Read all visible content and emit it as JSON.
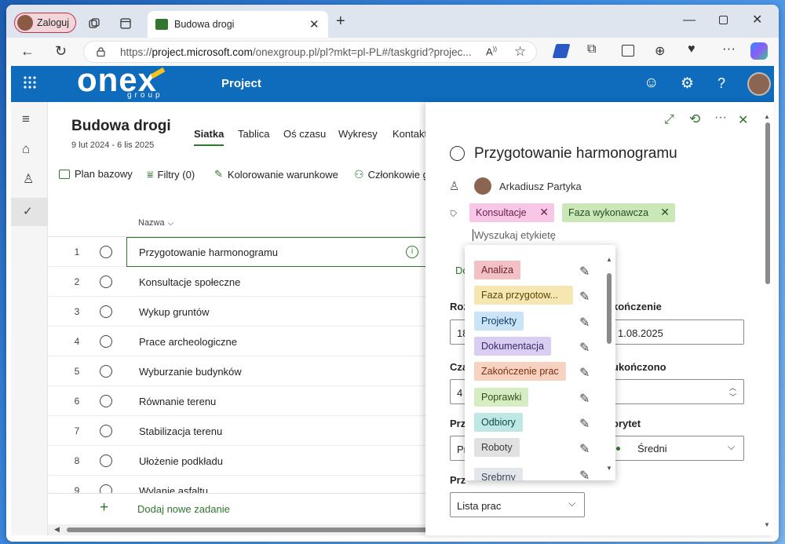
{
  "browser": {
    "profile_label": "Zaloguj",
    "tab_title": "Budowa drogi",
    "url_prefix": "https://",
    "url_domain": "project.microsoft.com",
    "url_rest": "/onexgroup.pl/pl?mkt=pl-PL#/taskgrid?projec...",
    "accent": "#0f6cbd"
  },
  "app": {
    "logo_text": "onex",
    "logo_sub": "group",
    "name": "Project"
  },
  "project": {
    "title": "Budowa drogi",
    "dates": "9 lut 2024 - 6 lis 2025",
    "tabs": [
      "Siatka",
      "Tablica",
      "Oś czasu",
      "Wykresy",
      "Kontakty"
    ],
    "toolbar": {
      "baseline": "Plan bazowy",
      "filters": "Filtry (0)",
      "coloring": "Kolorowanie warunkowe",
      "members": "Członkowie g"
    },
    "column_name": "Nazwa",
    "add_task": "Dodaj nowe zadanie"
  },
  "tasks": [
    {
      "num": "1",
      "name": "Przygotowanie harmonogramu"
    },
    {
      "num": "2",
      "name": "Konsultacje społeczne"
    },
    {
      "num": "3",
      "name": "Wykup gruntów"
    },
    {
      "num": "4",
      "name": "Prace archeologiczne"
    },
    {
      "num": "5",
      "name": "Wyburzanie budynków"
    },
    {
      "num": "6",
      "name": "Równanie terenu"
    },
    {
      "num": "7",
      "name": "Stabilizacja terenu"
    },
    {
      "num": "8",
      "name": "Ułożenie podkładu"
    },
    {
      "num": "9",
      "name": "Wylanie asfaltu"
    }
  ],
  "panel": {
    "task_title": "Przygotowanie harmonogramu",
    "assignee": "Arkadiusz Partyka",
    "tags": [
      {
        "label": "Konsultacje",
        "color": "#f7c7e5"
      },
      {
        "label": "Faza wykonawcza",
        "color": "#c9e7b7"
      }
    ],
    "tag_search_placeholder": "Wyszukaj etykietę",
    "fragment_do": "Do",
    "label_start_fragment": "Roz",
    "start_fragment": "18",
    "label_end_fragment": "kończenie",
    "end_value_fragment": "1.08.2025",
    "label_duration_fragment": "Cza",
    "duration_fragment": "4",
    "label_done_fragment": "ukończono",
    "label_p1_fragment": "Prz",
    "p1_value_fragment": "Pr",
    "label_priority_fragment": "orytet",
    "priority_value": "Średni",
    "label_p2_fragment": "Prz",
    "bucket_value": "Lista prac"
  },
  "dropdown": {
    "items": [
      {
        "label": "Analiza",
        "color": "#f1c1c6"
      },
      {
        "label": "Faza przygotow...",
        "color": "#f6e7b2"
      },
      {
        "label": "Projekty",
        "color": "#cbe3f7"
      },
      {
        "label": "Dokumentacja",
        "color": "#d9cdf2"
      },
      {
        "label": "Zakończenie prac",
        "color": "#f7d2c1"
      },
      {
        "label": "Poprawki",
        "color": "#d7ecc2"
      },
      {
        "label": "Odbiory",
        "color": "#bfe7e4"
      },
      {
        "label": "Roboty",
        "color": "#e1e1e1"
      },
      {
        "label": "Srebrny",
        "color": "#e3e6ea"
      }
    ]
  }
}
